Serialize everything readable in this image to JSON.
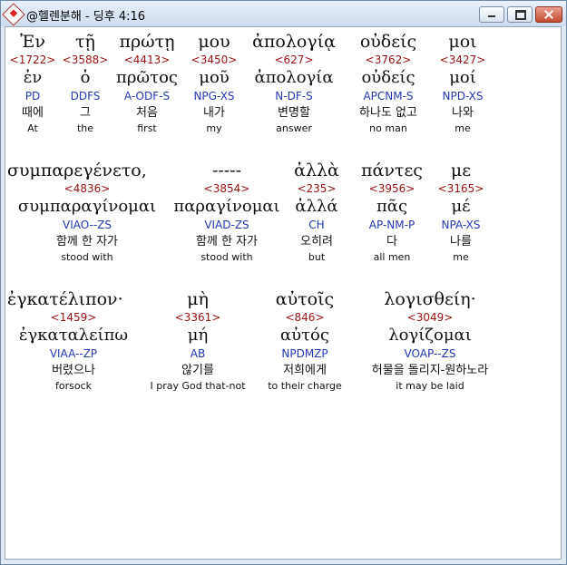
{
  "window": {
    "title": "@헬렌분해 - 딩후 4:16",
    "buttons": [
      "minimize",
      "maximize",
      "close"
    ]
  },
  "rows": [
    {
      "words": [
        {
          "greek": "Ἐν",
          "number": "<1722>",
          "lemma": "ἐν",
          "parse": "PD",
          "korean": "때에",
          "english": "At",
          "highlight": true
        },
        {
          "greek": "τῇ",
          "number": "<3588>",
          "lemma": "ὁ",
          "parse": "DDFS",
          "korean": "그",
          "english": "the"
        },
        {
          "greek": "πρώτῃ",
          "number": "<4413>",
          "lemma": "πρῶτος",
          "parse": "A-ODF-S",
          "korean": "처음",
          "english": "first"
        },
        {
          "greek": "μου",
          "number": "<3450>",
          "lemma": "μοῦ",
          "parse": "NPG-XS",
          "korean": "내가",
          "english": "my"
        },
        {
          "greek": "ἀπολογίᾳ",
          "number": "<627>",
          "lemma": "ἀπολογία",
          "parse": "N-DF-S",
          "korean": "변명할",
          "english": "answer"
        },
        {
          "greek": "οὐδείς",
          "number": "<3762>",
          "lemma": "οὐδείς",
          "parse": "APCNM-S",
          "korean": "하나도 없고",
          "english": "no man"
        },
        {
          "greek": "μοι",
          "number": "<3427>",
          "lemma": "μοί",
          "parse": "NPD-XS",
          "korean": "나와",
          "english": "me"
        }
      ]
    },
    {
      "words": [
        {
          "greek": "συμπαρεγένετο,",
          "number": "<4836>",
          "lemma": "συμπαραγίνομαι",
          "parse": "VIAO--ZS",
          "korean": "함께 한 자가",
          "english": "stood with"
        },
        {
          "greek": "-----",
          "number": "<3854>",
          "lemma": "παραγίνομαι",
          "parse": "VIAD-ZS",
          "korean": "함께 한 자가",
          "english": "stood with"
        },
        {
          "greek": "ἀλλὰ",
          "number": "<235>",
          "lemma": "ἀλλά",
          "parse": "CH",
          "korean": "오히려",
          "english": "but"
        },
        {
          "greek": "πάντες",
          "number": "<3956>",
          "lemma": "πᾶς",
          "parse": "AP-NM-P",
          "korean": "다",
          "english": "all men"
        },
        {
          "greek": "με",
          "number": "<3165>",
          "lemma": "μέ",
          "parse": "NPA-XS",
          "korean": "나를",
          "english": "me"
        }
      ]
    },
    {
      "words": [
        {
          "greek": "ἐγκατέλιπον·",
          "number": "<1459>",
          "lemma": "ἐγκαταλείπω",
          "parse": "VIAA--ZP",
          "korean": "버렸으나",
          "english": "forsock"
        },
        {
          "greek": "μὴ",
          "number": "<3361>",
          "lemma": "μή",
          "parse": "AB",
          "korean": "않기를",
          "english": "I pray God that-not"
        },
        {
          "greek": "αὐτοῖς",
          "number": "<846>",
          "lemma": "αὐτός",
          "parse": "NPDMZP",
          "korean": "저희에게",
          "english": "to their charge"
        },
        {
          "greek": "λογισθείη·",
          "number": "<3049>",
          "lemma": "λογίζομαι",
          "parse": "VOAP--ZS",
          "korean": "허물을 돌리지-원하노라",
          "english": "it may be laid"
        }
      ]
    }
  ]
}
